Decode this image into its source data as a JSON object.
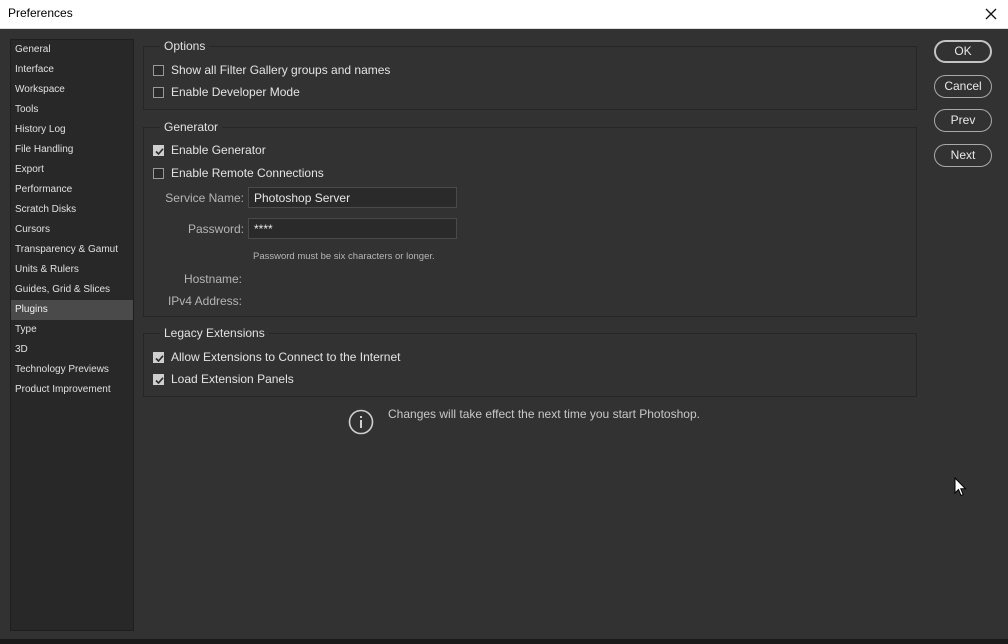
{
  "window": {
    "title": "Preferences"
  },
  "sidebar": {
    "items": [
      {
        "label": "General"
      },
      {
        "label": "Interface"
      },
      {
        "label": "Workspace"
      },
      {
        "label": "Tools"
      },
      {
        "label": "History Log"
      },
      {
        "label": "File Handling"
      },
      {
        "label": "Export"
      },
      {
        "label": "Performance"
      },
      {
        "label": "Scratch Disks"
      },
      {
        "label": "Cursors"
      },
      {
        "label": "Transparency & Gamut"
      },
      {
        "label": "Units & Rulers"
      },
      {
        "label": "Guides, Grid & Slices"
      },
      {
        "label": "Plugins"
      },
      {
        "label": "Type"
      },
      {
        "label": "3D"
      },
      {
        "label": "Technology Previews"
      },
      {
        "label": "Product Improvement"
      }
    ],
    "selected": "Plugins"
  },
  "options": {
    "legend": "Options",
    "show_filter_gallery": {
      "label": "Show all Filter Gallery groups and names",
      "checked": false
    },
    "developer_mode": {
      "label": "Enable Developer Mode",
      "checked": false
    }
  },
  "generator": {
    "legend": "Generator",
    "enable_generator": {
      "label": "Enable Generator",
      "checked": true
    },
    "remote_connections": {
      "label": "Enable Remote Connections",
      "checked": false
    },
    "service_name": {
      "label": "Service Name:",
      "value": "Photoshop Server"
    },
    "password": {
      "label": "Password:",
      "value": "****"
    },
    "password_hint": "Password must be six characters or longer.",
    "hostname": {
      "label": "Hostname:"
    },
    "ipv4": {
      "label": "IPv4 Address:"
    }
  },
  "legacy": {
    "legend": "Legacy Extensions",
    "allow_internet": {
      "label": "Allow Extensions to Connect to the Internet",
      "checked": true
    },
    "load_panels": {
      "label": "Load Extension Panels",
      "checked": true
    }
  },
  "notice": "Changes will take effect the next time you start Photoshop.",
  "buttons": {
    "ok": "OK",
    "cancel": "Cancel",
    "prev": "Prev",
    "next": "Next"
  },
  "colors": {
    "background": "#323232",
    "sidebar": "#282828",
    "selected": "#4a4a4a",
    "text": "#e4e4e4"
  },
  "icons": {
    "close": "close-icon",
    "info": "info-icon",
    "cursor": "mouse-pointer-icon",
    "checkmark": "checkmark-icon"
  }
}
